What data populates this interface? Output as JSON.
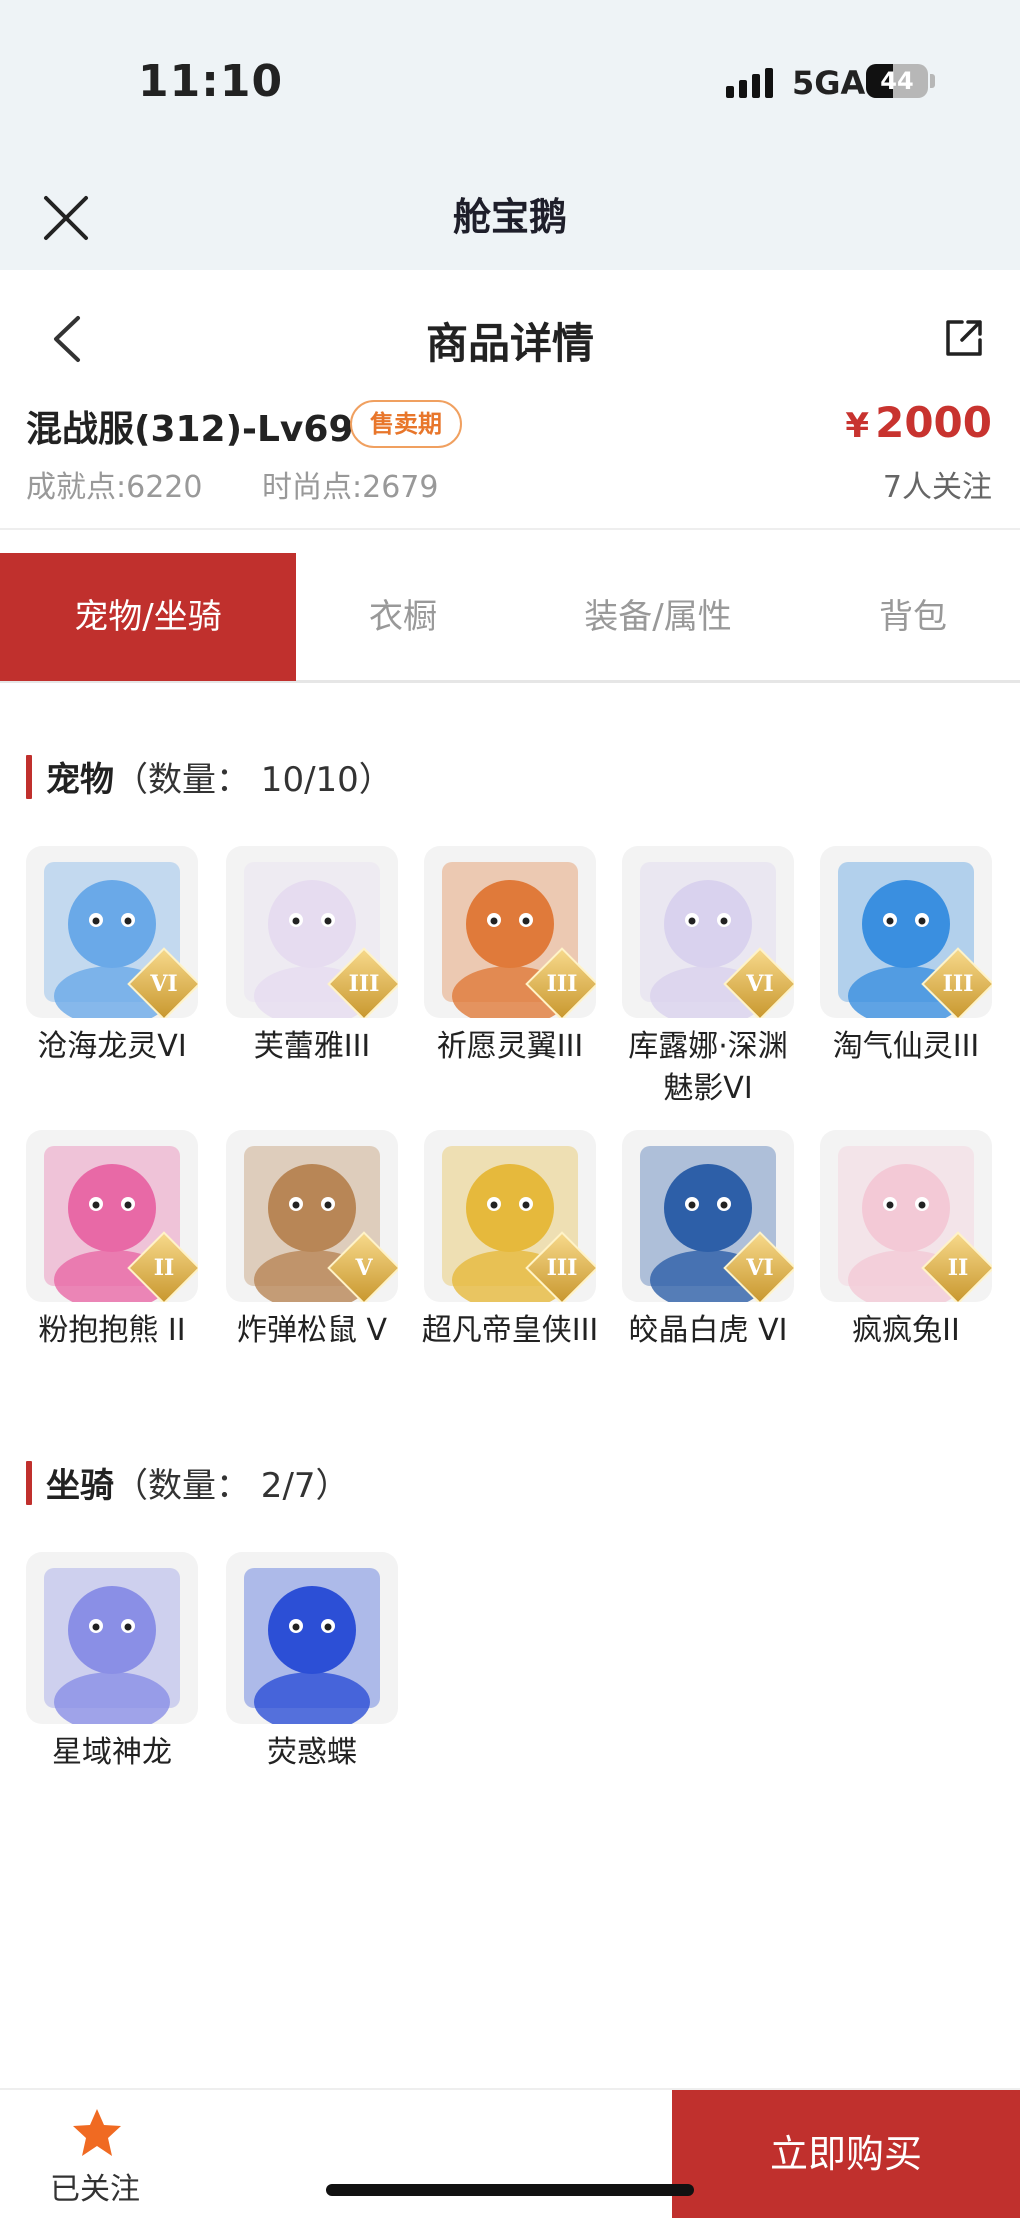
{
  "status_bar": {
    "time": "11:10",
    "network": "5GA",
    "battery": "44",
    "battery_level": 0.44
  },
  "mini_program": {
    "title": "舱宝鹅"
  },
  "nav": {
    "title": "商品详情"
  },
  "product": {
    "name": "混战服(312)-Lv69",
    "badge": "售卖期",
    "price_symbol": "¥",
    "price": "2000",
    "achievement": "成就点:6220",
    "fashion": "时尚点:2679",
    "followers": "7人关注"
  },
  "tabs": [
    {
      "label": "宠物/坐骑",
      "active": true
    },
    {
      "label": "衣橱",
      "active": false
    },
    {
      "label": "装备/属性",
      "active": false
    },
    {
      "label": "背包",
      "active": false
    }
  ],
  "pets": {
    "title": "宠物",
    "count": "（数量： 10/10）",
    "items": [
      {
        "name": "沧海龙灵VI",
        "tier": "VI",
        "icon": "dragon-spirit-icon",
        "color": "#6aa9e8"
      },
      {
        "name": "芙蕾雅III",
        "tier": "III",
        "icon": "angel-girl-icon",
        "color": "#e6dcf0"
      },
      {
        "name": "祈愿灵翼III",
        "tier": "III",
        "icon": "eagle-icon",
        "color": "#e07a3a"
      },
      {
        "name": "库露娜·深渊魅影VI",
        "tier": "VI",
        "icon": "abyss-girl-icon",
        "color": "#d9d2ee"
      },
      {
        "name": "淘气仙灵III",
        "tier": "III",
        "icon": "blue-puppy-icon",
        "color": "#3a8fe0"
      },
      {
        "name": "粉抱抱熊 II",
        "tier": "II",
        "icon": "pink-bear-icon",
        "color": "#e869a6"
      },
      {
        "name": "炸弹松鼠 V",
        "tier": "V",
        "icon": "bomb-squirrel-icon",
        "color": "#b88656"
      },
      {
        "name": "超凡帝皇侠III",
        "tier": "III",
        "icon": "golden-knight-icon",
        "color": "#e6b93c"
      },
      {
        "name": "皎晶白虎 VI",
        "tier": "VI",
        "icon": "white-tiger-icon",
        "color": "#2d5fa8"
      },
      {
        "name": "疯疯兔II",
        "tier": "II",
        "icon": "bunny-icon",
        "color": "#f3c9d6"
      }
    ]
  },
  "mounts": {
    "title": "坐骑",
    "count": "（数量： 2/7）",
    "items": [
      {
        "name": "星域神龙",
        "icon": "star-dragon-icon",
        "color": "#8a8fe6"
      },
      {
        "name": "荧惑蝶",
        "icon": "firefly-butterfly-icon",
        "color": "#2c4fd6"
      }
    ]
  },
  "bottom": {
    "follow_label": "已关注",
    "buy_label": "立即购买"
  },
  "colors": {
    "accent": "#c0302d",
    "badge": "#e8762b",
    "price": "#c8332f"
  }
}
